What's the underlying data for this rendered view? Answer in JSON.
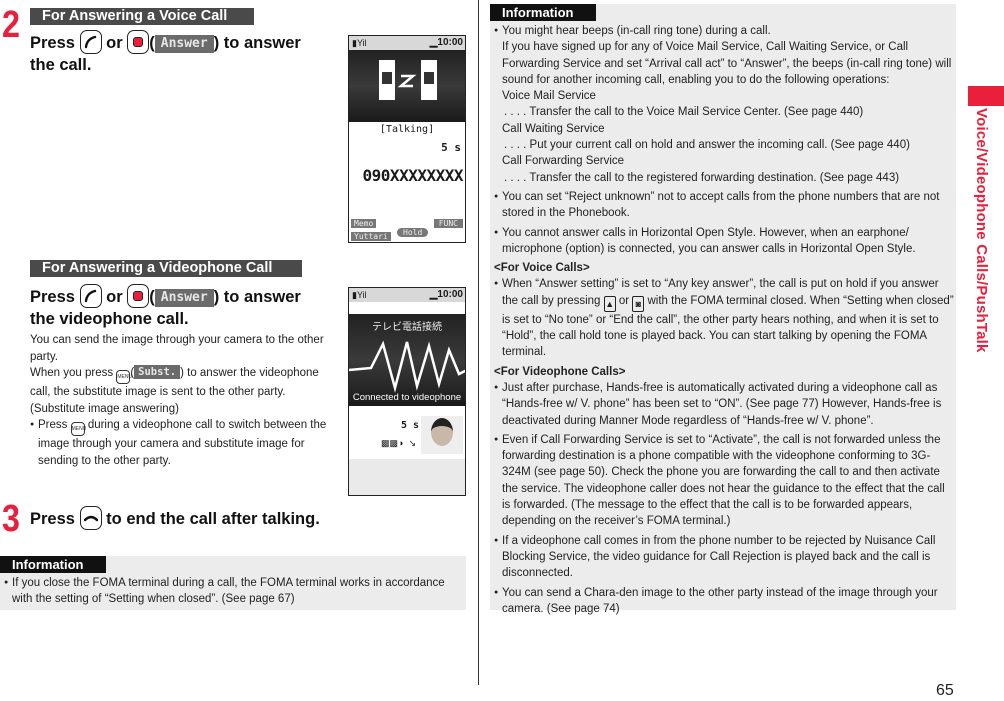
{
  "side_title": "Voice/Videophone Calls/PushTalk",
  "page_number": "65",
  "step2": {
    "number": "2",
    "voice": {
      "section_label": "For Answering a Voice Call",
      "instruction_press": "Press",
      "instruction_or": "or",
      "softkey": "Answer",
      "instruction_tail": ") to answer",
      "instruction_line2": "the call.",
      "screen": {
        "time": "10:00",
        "status_label": "[Talking]",
        "duration": "5 s",
        "phone_number": "090XXXXXXXX",
        "softkeys": [
          "Memo",
          "Yuttari",
          "Hold",
          "FUNC"
        ]
      }
    },
    "video": {
      "section_label": "For Answering a Videophone Call",
      "instruction_press": "Press",
      "instruction_or": "or",
      "softkey": "Answer",
      "instruction_tail": ") to answer",
      "instruction_line2": "the videophone call.",
      "desc1": "You can send the image through your camera to the other party.",
      "desc2_pre": "When you press",
      "desc2_softkey": "Subst.",
      "desc2_post": ") to answer the videophone call, the substitute image is sent to the other party.",
      "desc3": "(Substitute image answering)",
      "bullet_pre": "Press",
      "bullet_post": "during a videophone call to switch between the image through your camera and substitute image for sending to the other party.",
      "menu_key_label": "MENU",
      "screen": {
        "time": "10:00",
        "jp_label": "テレビ電話接続",
        "connected_label": "Connected to videophone",
        "duration": "5 s"
      }
    }
  },
  "step3": {
    "number": "3",
    "instruction_press": "Press",
    "instruction_tail": "to end the call after talking."
  },
  "info_left": {
    "label": "Information",
    "items": [
      "If you close the FOMA terminal during a call, the FOMA terminal works in accordance with the setting of “Setting when closed”. (See page 67)"
    ]
  },
  "info_right": {
    "label": "Information",
    "item1_lines": [
      "You might hear beeps (in-call ring tone) during a call.",
      "If you have signed up for any of Voice Mail Service, Call Waiting Service, or Call Forwarding Service and set “Arrival call act” to “Answer”, the beeps (in-call ring tone) will sound for another incoming call, enabling you to do the following operations:"
    ],
    "services": [
      {
        "name": "Voice Mail Service",
        "desc": ". . . . Transfer the call to the Voice Mail Service Center. (See page 440)"
      },
      {
        "name": "Call Waiting Service",
        "desc": ". . . . Put your current call on hold and answer the incoming call. (See page 440)"
      },
      {
        "name": "Call Forwarding Service",
        "desc": ". . . . Transfer the call to the registered forwarding destination. (See page 443)"
      }
    ],
    "item2": "You can set “Reject unknown” not to accept calls from the phone numbers that are not stored in the Phonebook.",
    "item3": "You cannot answer calls in Horizontal Open Style. However, when an earphone/ microphone (option) is connected, you can answer calls in Horizontal Open Style.",
    "voice_heading": "<For Voice Calls>",
    "voice_item_pre": "When “Answer setting” is set to “Any key answer”, the call is put on hold if you answer the call by pressing",
    "voice_item_or": "or",
    "voice_item_post": "with the FOMA terminal closed. When “Setting when closed” is set to “No tone” or “End the call”, the other party hears nothing, and when it is set to “Hold”, the call hold tone is played back. You can start talking by opening the FOMA terminal.",
    "video_heading": "<For Videophone Calls>",
    "video_items": [
      "Just after purchase, Hands-free is automatically activated during a videophone call as “Hands-free w/ V. phone” has been set to “ON”. (See page 77) However, Hands-free is deactivated during Manner Mode regardless of “Hands-free w/ V. phone”.",
      "Even if Call Forwarding Service is set to “Activate”, the call is not forwarded unless the forwarding destination is a phone compatible with the videophone conforming to 3G-324M (see page 50). Check the phone you are forwarding the call to and then activate the service. The videophone caller does not hear the guidance to the effect that the call is forwarded. (The message to the effect that the call is to be forwarded appears, depending on the receiver’s FOMA terminal.)",
      "If a videophone call comes in from the phone number to be rejected by Nuisance Call Blocking Service, the video guidance for Call Rejection is played back and the call is disconnected.",
      "You can send a Chara-den image to the other party instead of the image through your camera. (See page 74)"
    ]
  },
  "colors": {
    "accent_red": "#e8203c",
    "section_bar": "#4a4a4a",
    "info_bg": "#ececec"
  }
}
